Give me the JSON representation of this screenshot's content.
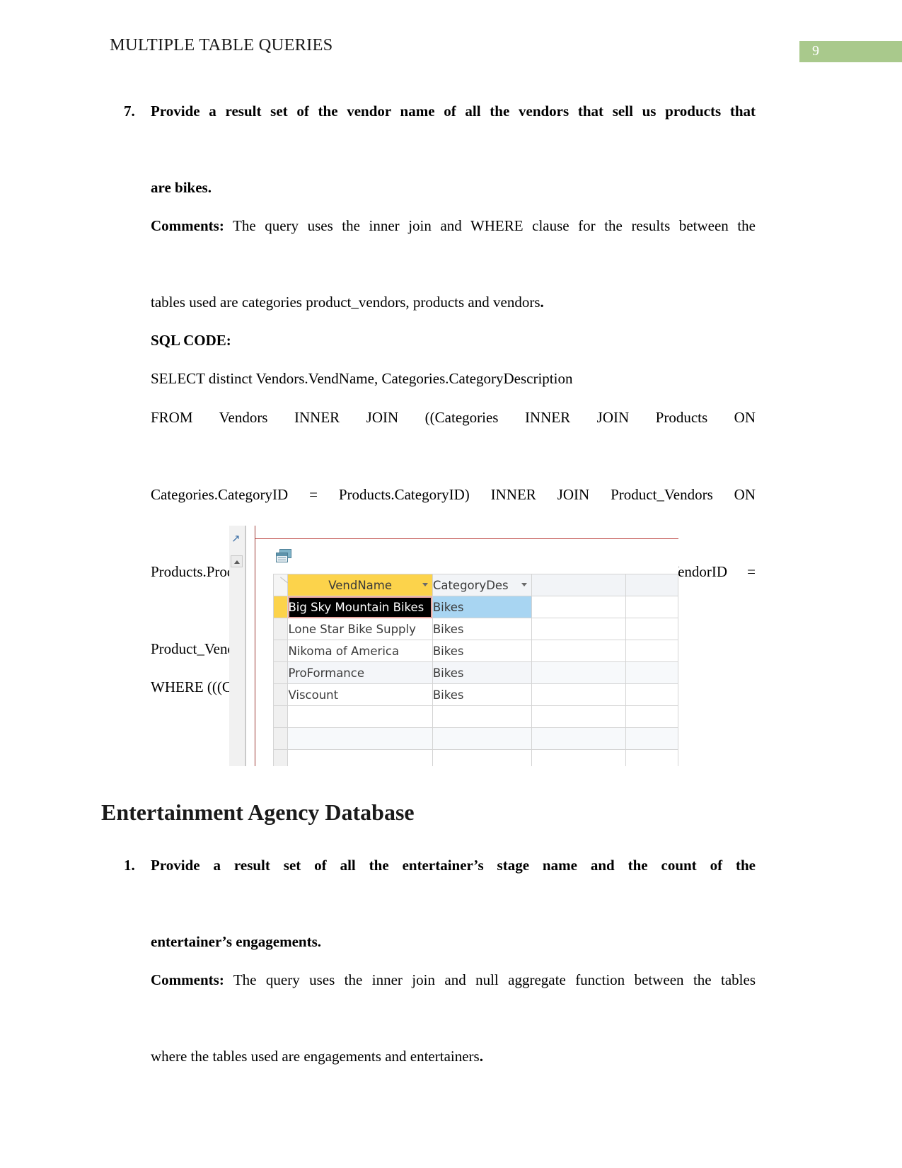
{
  "header": {
    "title": "MULTIPLE TABLE QUERIES",
    "page_number": "9",
    "page_number_color": "#a9c98c"
  },
  "questions": [
    {
      "number": "7.",
      "prompt_line1": "Provide a result set of the vendor name of all the vendors that sell us products that",
      "prompt_line2": "are bikes.",
      "comments_label": "Comments:",
      "comments_line1": "The query uses the inner join and WHERE clause for the results between the",
      "comments_line2": "tables used are categories product_vendors, products and vendors",
      "comments_period": ".",
      "sql_label": "SQL CODE:",
      "sql_lines": [
        "SELECT distinct Vendors.VendName, Categories.CategoryDescription",
        "FROM Vendors INNER JOIN ((Categories INNER JOIN Products ON",
        "Categories.CategoryID = Products.CategoryID) INNER JOIN Product_Vendors ON",
        "Products.ProductNumber = Product_Vendors.ProductNumber) ON Vendors.VendorID =",
        "Product_Vendors.VendorID",
        "WHERE (((Categories.CategoryDescription)='bikes'));"
      ]
    }
  ],
  "access_result": {
    "columns": [
      "VendName",
      "CategoryDes"
    ],
    "rows": [
      {
        "VendName": "Big Sky Mountain Bikes",
        "CategoryDescription": "Bikes"
      },
      {
        "VendName": "Lone Star Bike Supply",
        "CategoryDescription": "Bikes"
      },
      {
        "VendName": "Nikoma of America",
        "CategoryDescription": "Bikes"
      },
      {
        "VendName": "ProFormance",
        "CategoryDescription": "Bikes"
      },
      {
        "VendName": "Viscount",
        "CategoryDescription": "Bikes"
      }
    ],
    "selected_row_index": 0,
    "header_accent_color": "#fcd34b",
    "selection_highlight_color": "#a8d5f2"
  },
  "section": {
    "heading": "Entertainment Agency Database",
    "question": {
      "number": "1.",
      "prompt_line1": "Provide a result set of all the entertainer’s stage name and the count of the",
      "prompt_line2": "entertainer’s engagements.",
      "comments_label": "Comments:",
      "comments_line1": "The query uses the inner join and null aggregate function between the tables",
      "comments_line2": "where the tables used are engagements and entertainers",
      "comments_period": "."
    }
  }
}
